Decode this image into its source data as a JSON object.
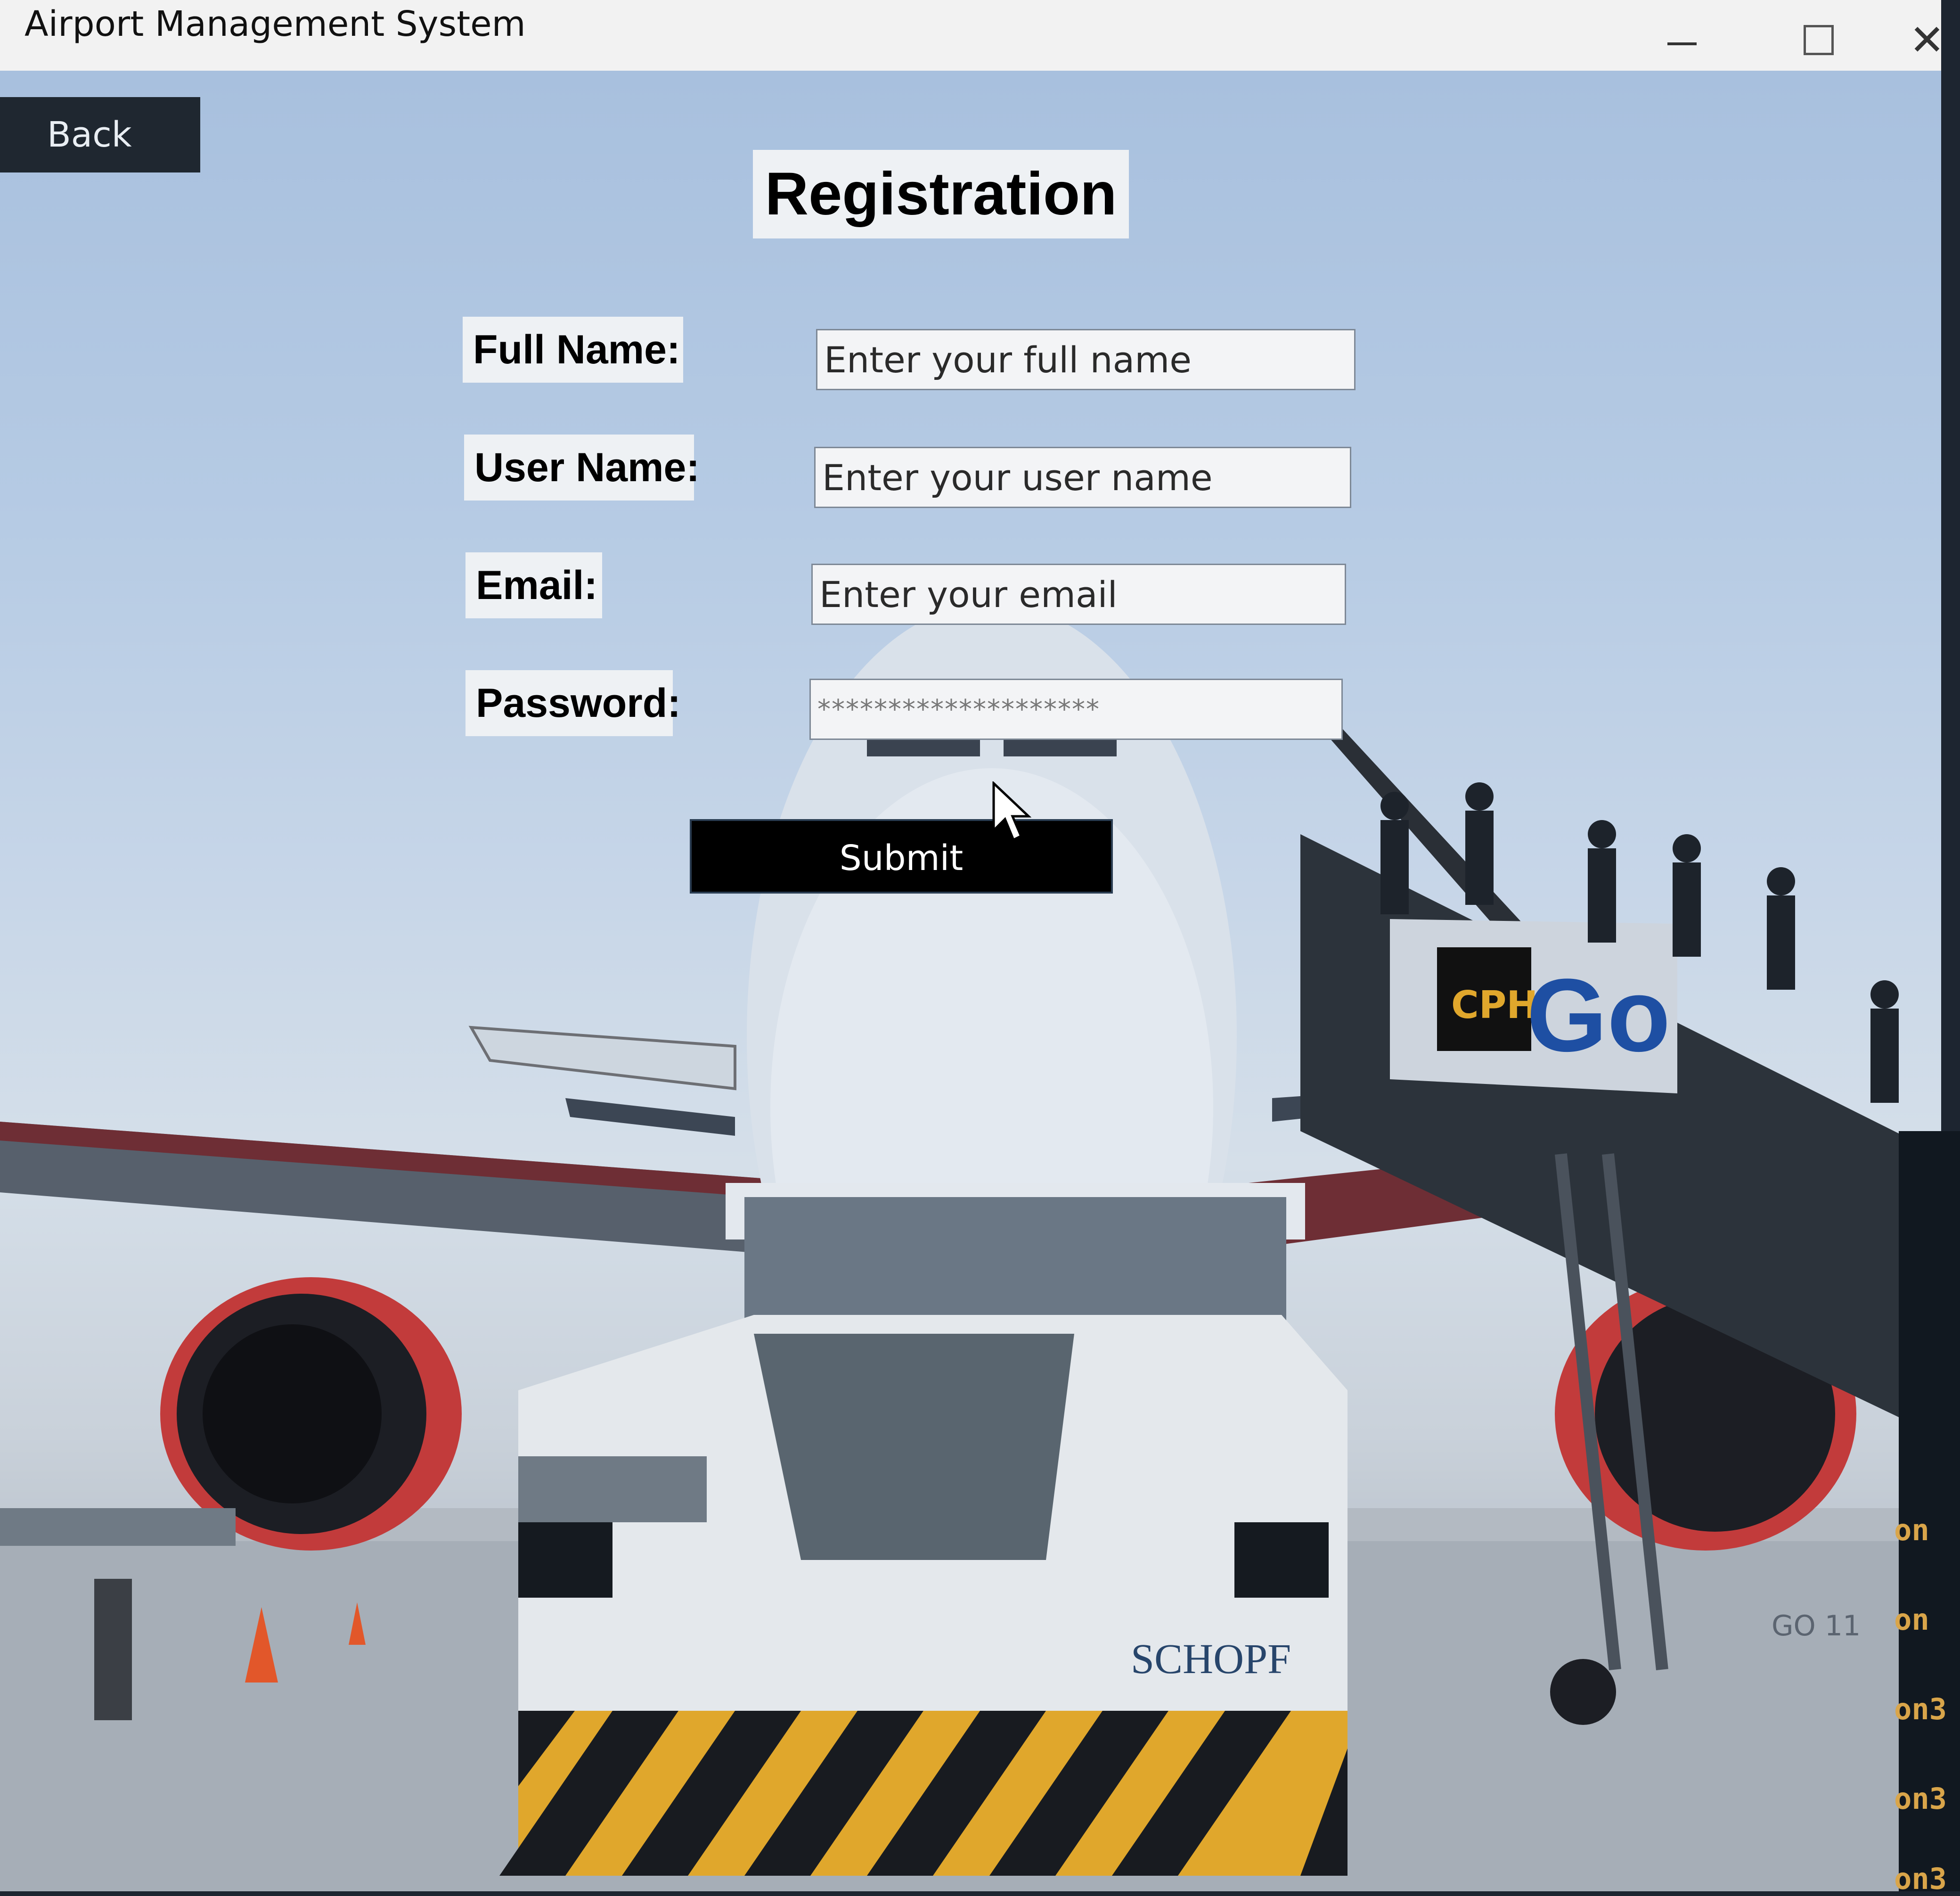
{
  "window": {
    "title": "Airport Management System",
    "controls": {
      "minimize": "—",
      "maximize": "☐",
      "close": "✕"
    }
  },
  "nav": {
    "back_label": "Back"
  },
  "form": {
    "title": "Registration",
    "fields": [
      {
        "label": "Full Name:",
        "placeholder": "Enter your full name"
      },
      {
        "label": "User Name:",
        "placeholder": "Enter your user name"
      },
      {
        "label": "Email:",
        "placeholder": "Enter your email"
      },
      {
        "label": "Password:",
        "placeholder": "********************"
      }
    ],
    "submit_label": "Submit"
  },
  "background": {
    "stair_logo": "CPH",
    "stair_text": "Go",
    "tug_brand": "SCHOPF",
    "small_sign": "GO 11"
  },
  "side_text": [
    "on",
    "on",
    "on3",
    "on3",
    "on3"
  ],
  "colors": {
    "button_bg": "#000000",
    "back_bg": "#1f2730",
    "sky": "#b6cbe4",
    "engine_red": "#c23b3b",
    "hazard_yellow": "#e0a72c"
  }
}
